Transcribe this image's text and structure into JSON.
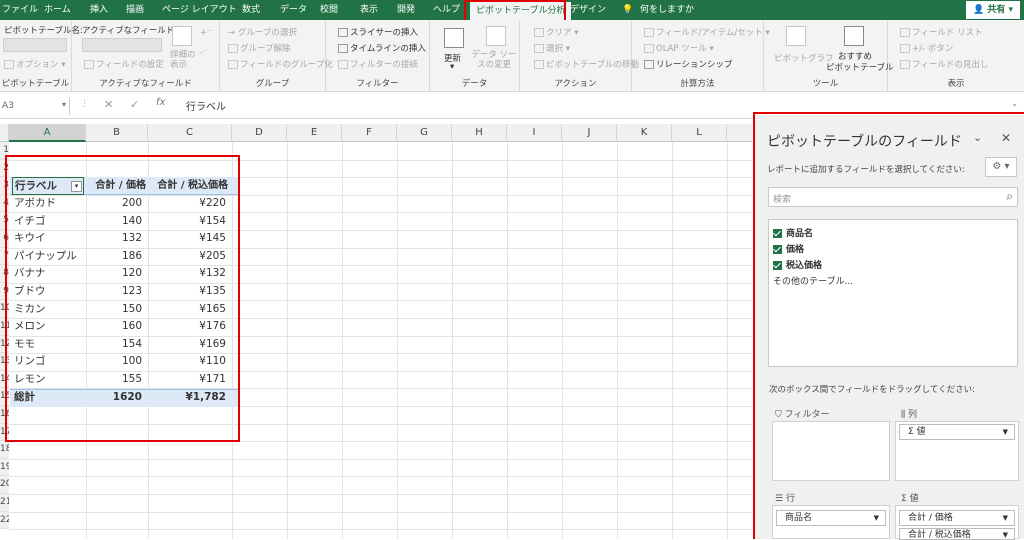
{
  "tabs": [
    "ファイル",
    "ホーム",
    "挿入",
    "描画",
    "ページ レイアウト",
    "数式",
    "データ",
    "校閲",
    "表示",
    "開発",
    "ヘルプ",
    "ピボットテーブル分析",
    "デザイン",
    "何をしますか"
  ],
  "share": "共有",
  "ribbon": {
    "pivot_name_label": "ピボットテーブル名:",
    "active_field_label": "アクティブなフィールド:",
    "options": "オプション",
    "field_settings": "フィールドの設定",
    "detail_display": "詳細の表示",
    "group_selection": "グループの選択",
    "ungroup": "グループ解除",
    "group_field": "フィールドのグループ化",
    "insert_slicer": "スライサーの挿入",
    "insert_timeline": "タイムラインの挿入",
    "filter_connections": "フィルターの接続",
    "refresh": "更新",
    "change_source": "データ ソースの変更",
    "clear": "クリア",
    "select": "選択",
    "move_pivot": "ピボットテーブルの移動",
    "fields_items_sets": "フィールド/アイテム/セット",
    "olap_tools": "OLAP ツール",
    "relationships": "リレーションシップ",
    "pivot_chart": "ピボットグラフ",
    "recommended_1": "おすすめ",
    "recommended_2": "ピボットテーブル",
    "field_list": "フィールド リスト",
    "plusminus": "+/- ボタン",
    "field_headers": "フィールドの見出し",
    "groups": [
      "ピボットテーブル",
      "アクティブなフィールド",
      "グループ",
      "フィルター",
      "データ",
      "アクション",
      "計算方法",
      "ツール",
      "表示"
    ]
  },
  "formula": {
    "namebox": "A3",
    "fx": "fx",
    "value": "行ラベル"
  },
  "columns": [
    "A",
    "B",
    "C",
    "D",
    "E",
    "F",
    "G",
    "H",
    "I",
    "J",
    "K",
    "L"
  ],
  "rows": [
    "1",
    "2",
    "3",
    "4",
    "5",
    "6",
    "7",
    "8",
    "9",
    "10",
    "11",
    "12",
    "13",
    "14",
    "15",
    "16",
    "17",
    "18",
    "19",
    "20",
    "21",
    "22"
  ],
  "pivot": {
    "headers": [
      "行ラベル",
      "合計 / 価格",
      "合計 / 税込価格"
    ],
    "items": [
      {
        "name": "アボカド",
        "price": "200",
        "tax": "¥220"
      },
      {
        "name": "イチゴ",
        "price": "140",
        "tax": "¥154"
      },
      {
        "name": "キウイ",
        "price": "132",
        "tax": "¥145"
      },
      {
        "name": "パイナップル",
        "price": "186",
        "tax": "¥205"
      },
      {
        "name": "バナナ",
        "price": "120",
        "tax": "¥132"
      },
      {
        "name": "ブドウ",
        "price": "123",
        "tax": "¥135"
      },
      {
        "name": "ミカン",
        "price": "150",
        "tax": "¥165"
      },
      {
        "name": "メロン",
        "price": "160",
        "tax": "¥176"
      },
      {
        "name": "モモ",
        "price": "154",
        "tax": "¥169"
      },
      {
        "name": "リンゴ",
        "price": "100",
        "tax": "¥110"
      },
      {
        "name": "レモン",
        "price": "155",
        "tax": "¥171"
      }
    ],
    "total": {
      "label": "総計",
      "price": "1620",
      "tax": "¥1,782"
    }
  },
  "pane": {
    "title": "ピボットテーブルのフィールド",
    "choose_label": "レポートに追加するフィールドを選択してください:",
    "search_placeholder": "検索",
    "fields": [
      "商品名",
      "価格",
      "税込価格"
    ],
    "other_tables": "その他のテーブル...",
    "drag_label": "次のボックス間でフィールドをドラッグしてください:",
    "filter_area": "フィルター",
    "columns_area": "列",
    "rows_area": "行",
    "values_area": "値",
    "columns_item": "Σ 値",
    "rows_item": "商品名",
    "values_items": [
      "合計 / 価格",
      "合計 / 税込価格"
    ]
  },
  "colors": {
    "excel_green": "#217346",
    "highlight_red": "#e00000",
    "pivot_header": "#dde9f6"
  }
}
